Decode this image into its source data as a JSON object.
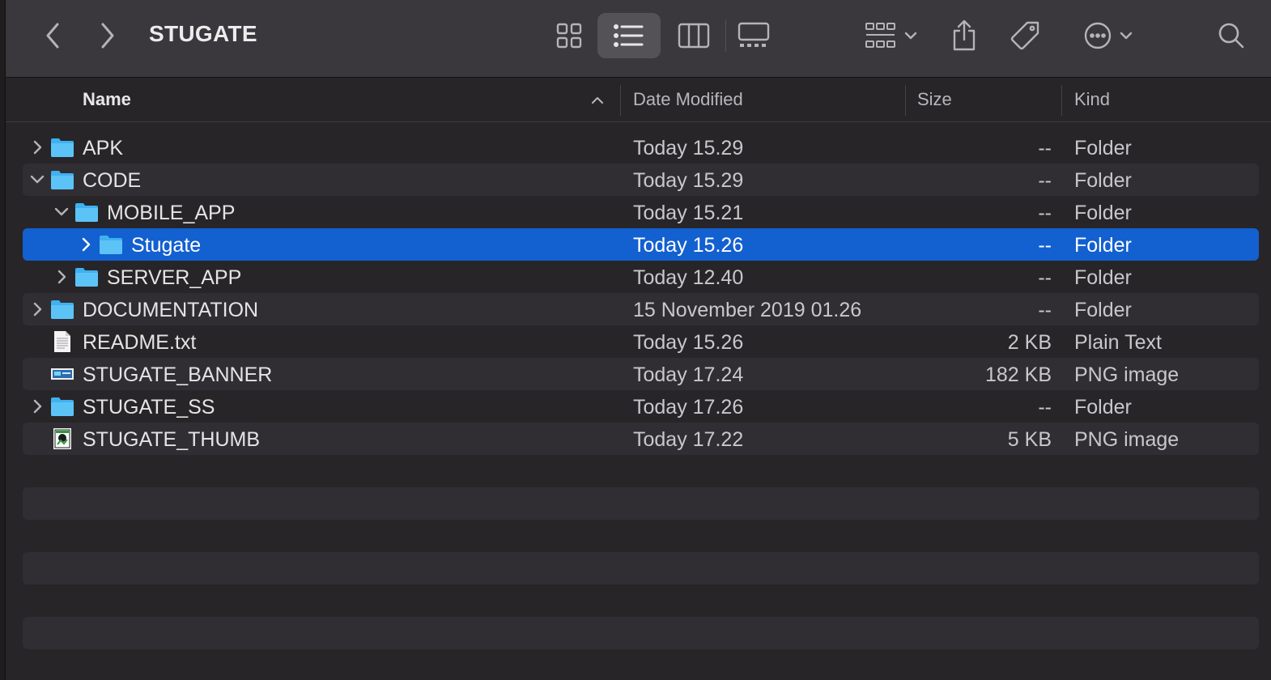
{
  "window": {
    "title": "STUGATE"
  },
  "toolbar": {
    "icons": [
      "chevron-left-icon",
      "chevron-right-icon",
      "icon-view-icon",
      "list-view-icon",
      "column-view-icon",
      "gallery-view-icon",
      "group-icon",
      "share-icon",
      "tag-icon",
      "more-icon",
      "search-icon"
    ],
    "active_view": "list"
  },
  "columns": {
    "name": "Name",
    "date": "Date Modified",
    "size": "Size",
    "kind": "Kind"
  },
  "rows": [
    {
      "name": "APK",
      "date": "Today 15.29",
      "size": "--",
      "kind": "Folder",
      "type": "folder",
      "indent": 0,
      "expanded": false
    },
    {
      "name": "CODE",
      "date": "Today 15.29",
      "size": "--",
      "kind": "Folder",
      "type": "folder",
      "indent": 0,
      "expanded": true
    },
    {
      "name": "MOBILE_APP",
      "date": "Today 15.21",
      "size": "--",
      "kind": "Folder",
      "type": "folder",
      "indent": 1,
      "expanded": true
    },
    {
      "name": "Stugate",
      "date": "Today 15.26",
      "size": "--",
      "kind": "Folder",
      "type": "folder",
      "indent": 2,
      "expanded": false,
      "selected": true
    },
    {
      "name": "SERVER_APP",
      "date": "Today 12.40",
      "size": "--",
      "kind": "Folder",
      "type": "folder",
      "indent": 1,
      "expanded": false
    },
    {
      "name": "DOCUMENTATION",
      "date": "15 November 2019 01.26",
      "size": "--",
      "kind": "Folder",
      "type": "folder",
      "indent": 0,
      "expanded": false
    },
    {
      "name": "README.txt",
      "date": "Today 15.26",
      "size": "2 KB",
      "kind": "Plain Text",
      "type": "text",
      "indent": 0
    },
    {
      "name": "STUGATE_BANNER",
      "date": "Today 17.24",
      "size": "182 KB",
      "kind": "PNG image",
      "type": "image-banner",
      "indent": 0
    },
    {
      "name": "STUGATE_SS",
      "date": "Today 17.26",
      "size": "--",
      "kind": "Folder",
      "type": "folder",
      "indent": 0,
      "expanded": false
    },
    {
      "name": "STUGATE_THUMB",
      "date": "Today 17.22",
      "size": "5 KB",
      "kind": "PNG image",
      "type": "image-thumb",
      "indent": 0
    }
  ],
  "colors": {
    "selection": "#1360d0",
    "folder": "#3fb1f0",
    "toolbar": "#3a383c"
  }
}
